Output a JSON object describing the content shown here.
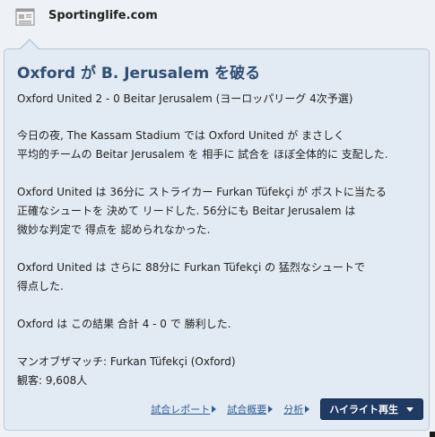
{
  "source": {
    "name": "Sportinglife.com",
    "icon": "newspaper-icon"
  },
  "article": {
    "headline": "Oxford が B. Jerusalem を破る",
    "subline": "Oxford United 2 - 0 Beitar Jerusalem (ヨーロッパリーグ 4次予選)",
    "paragraphs": [
      [
        "今日の夜, The Kassam Stadium では Oxford United が まさしく",
        "平均的チームの Beitar Jerusalem を 相手に 試合を ほぼ全体的に 支配した."
      ],
      [
        "Oxford United は 36分に ストライカー Furkan Tüfekçi が ポストに当たる",
        "正確なシュートを 決めて リードした. 56分にも Beitar Jerusalem は",
        "微妙な判定で 得点を 認められなかった."
      ],
      [
        "Oxford United は さらに 88分に Furkan Tüfekçi の 猛烈なシュートで",
        "得点した."
      ],
      [
        "Oxford は この結果 合計 4 - 0 で 勝利した."
      ]
    ],
    "man_of_match": "マンオブザマッチ: Furkan Tüfekçi (Oxford)",
    "attendance": "観客: 9,608人"
  },
  "actions": {
    "match_report": "試合レポート",
    "match_summary": "試合概要",
    "analysis": "分析",
    "highlights": "ハイライト再生"
  }
}
